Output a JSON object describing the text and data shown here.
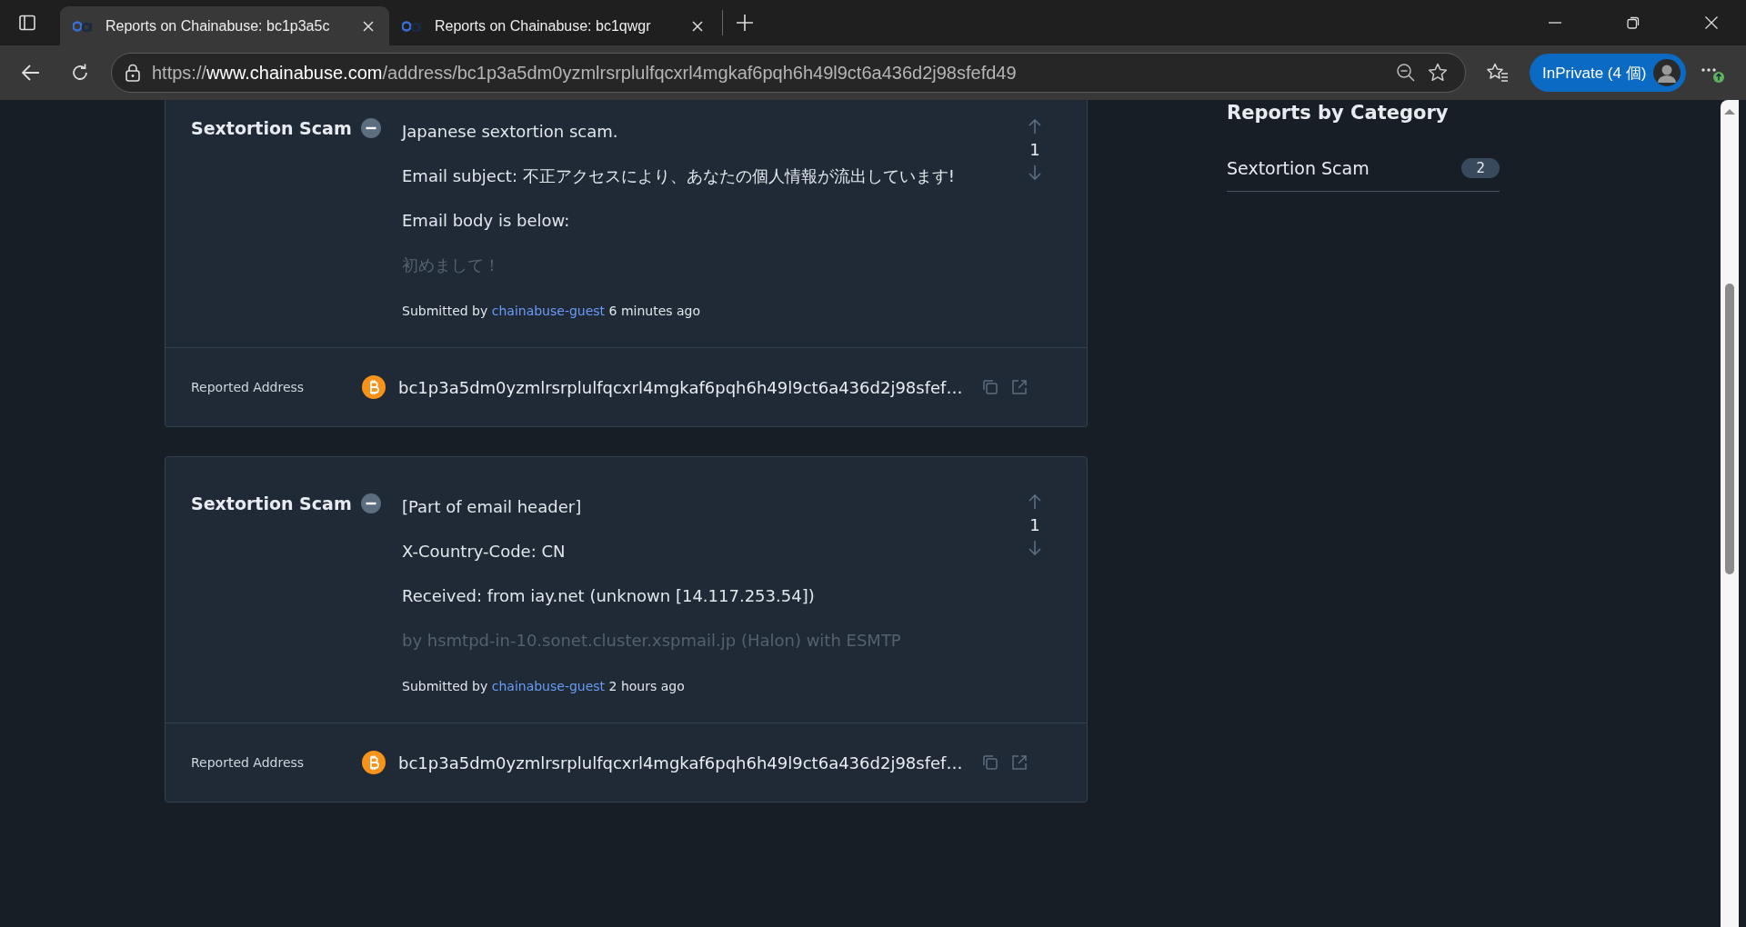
{
  "browser": {
    "tabs": [
      {
        "title": "Reports on Chainabuse: bc1p3a5c",
        "selected": true
      },
      {
        "title": "Reports on Chainabuse: bc1qwgr",
        "selected": false
      }
    ],
    "url": {
      "scheme": "https://",
      "host": "www.chainabuse.com",
      "path": "/address/bc1p3a5dm0yzmlrsrplulfqcxrl4mgkaf6pqh6h49l9ct6a436d2j98sfefd49"
    },
    "profile_button": "InPrivate (4 個)"
  },
  "reports": [
    {
      "category": "Sextortion Scam",
      "paragraphs": [
        {
          "text": "Japanese sextortion scam.",
          "faded": false
        },
        {
          "text": "Email subject: 不正アクセスにより、あなたの個人情報が流出しています!",
          "faded": false
        },
        {
          "text": "Email body is below:",
          "faded": false
        },
        {
          "text": "初めまして！",
          "faded": true
        }
      ],
      "votes": "1",
      "submitted_label": "Submitted by",
      "submitter": "chainabuse-guest",
      "time": "6 minutes ago",
      "address_label": "Reported Address",
      "address": "bc1p3a5dm0yzmlrsrplulfqcxrl4mgkaf6pqh6h49l9ct6a436d2j98sfef…"
    },
    {
      "category": "Sextortion Scam",
      "paragraphs": [
        {
          "text": "[Part of email header]",
          "faded": false
        },
        {
          "text": "X-Country-Code: CN",
          "faded": false
        },
        {
          "text": "Received: from iay.net (unknown [14.117.253.54])",
          "faded": false
        },
        {
          "text": "by hsmtpd-in-10.sonet.cluster.xspmail.jp (Halon) with ESMTP",
          "faded": true
        }
      ],
      "votes": "1",
      "submitted_label": "Submitted by",
      "submitter": "chainabuse-guest",
      "time": "2 hours ago",
      "address_label": "Reported Address",
      "address": "bc1p3a5dm0yzmlrsrplulfqcxrl4mgkaf6pqh6h49l9ct6a436d2j98sfef…"
    }
  ],
  "sidebar": {
    "title": "Reports by Category",
    "categories": [
      {
        "name": "Sextortion Scam",
        "count": "2"
      }
    ]
  }
}
